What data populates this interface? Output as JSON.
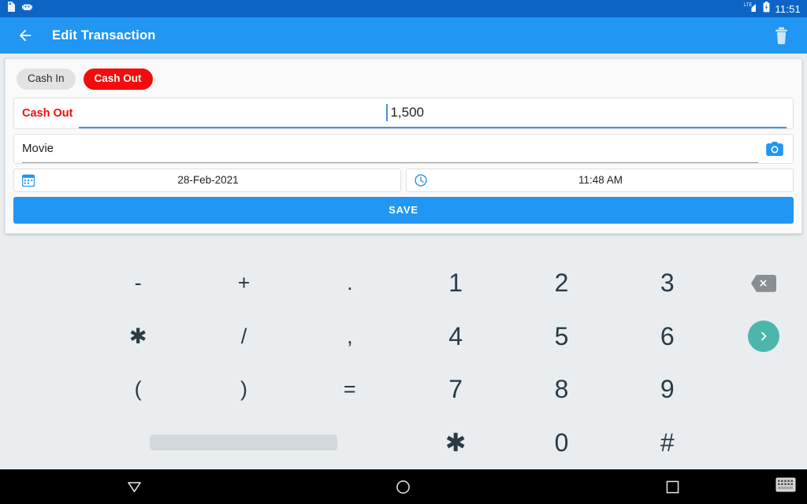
{
  "statusbar": {
    "time": "11:51",
    "icons": [
      "sd-card-icon",
      "android-robot-icon",
      "lte-signal-icon",
      "battery-icon"
    ],
    "network_label": "LTE",
    "background": "#0c65c4"
  },
  "appbar": {
    "title": "Edit Transaction",
    "back_icon": "back-arrow-icon",
    "delete_icon": "trash-icon",
    "background": "#2196f3"
  },
  "form": {
    "chips": [
      {
        "label": "Cash In",
        "selected": false
      },
      {
        "label": "Cash Out",
        "selected": true
      }
    ],
    "amount": {
      "label": "Cash Out",
      "value": "1,500",
      "label_color": "#f40b0b",
      "underline_color": "#4a90e2"
    },
    "note": {
      "value": "Movie",
      "camera_icon": "camera-icon"
    },
    "date": {
      "value": "28-Feb-2021",
      "icon": "calendar-icon"
    },
    "time": {
      "value": "11:48 AM",
      "icon": "clock-icon"
    },
    "save_label": "SAVE"
  },
  "keyboard": {
    "rows": [
      [
        "-",
        "+",
        ".",
        "1",
        "2",
        "3"
      ],
      [
        "✱",
        "/",
        ",",
        "4",
        "5",
        "6"
      ],
      [
        "(",
        ")",
        "=",
        "7",
        "8",
        "9"
      ],
      [
        "",
        "",
        "",
        "✱",
        "0",
        "#"
      ]
    ],
    "spacebar_label": "",
    "backspace_icon": "backspace-icon",
    "enter_icon": "chevron-right-icon",
    "background": "#e9edf0",
    "enter_color": "#4db6ac"
  },
  "navbar": {
    "back_icon": "nav-back-triangle-icon",
    "home_icon": "nav-home-circle-icon",
    "recents_icon": "nav-recents-square-icon",
    "keyboard_switch_icon": "keyboard-switch-icon"
  }
}
